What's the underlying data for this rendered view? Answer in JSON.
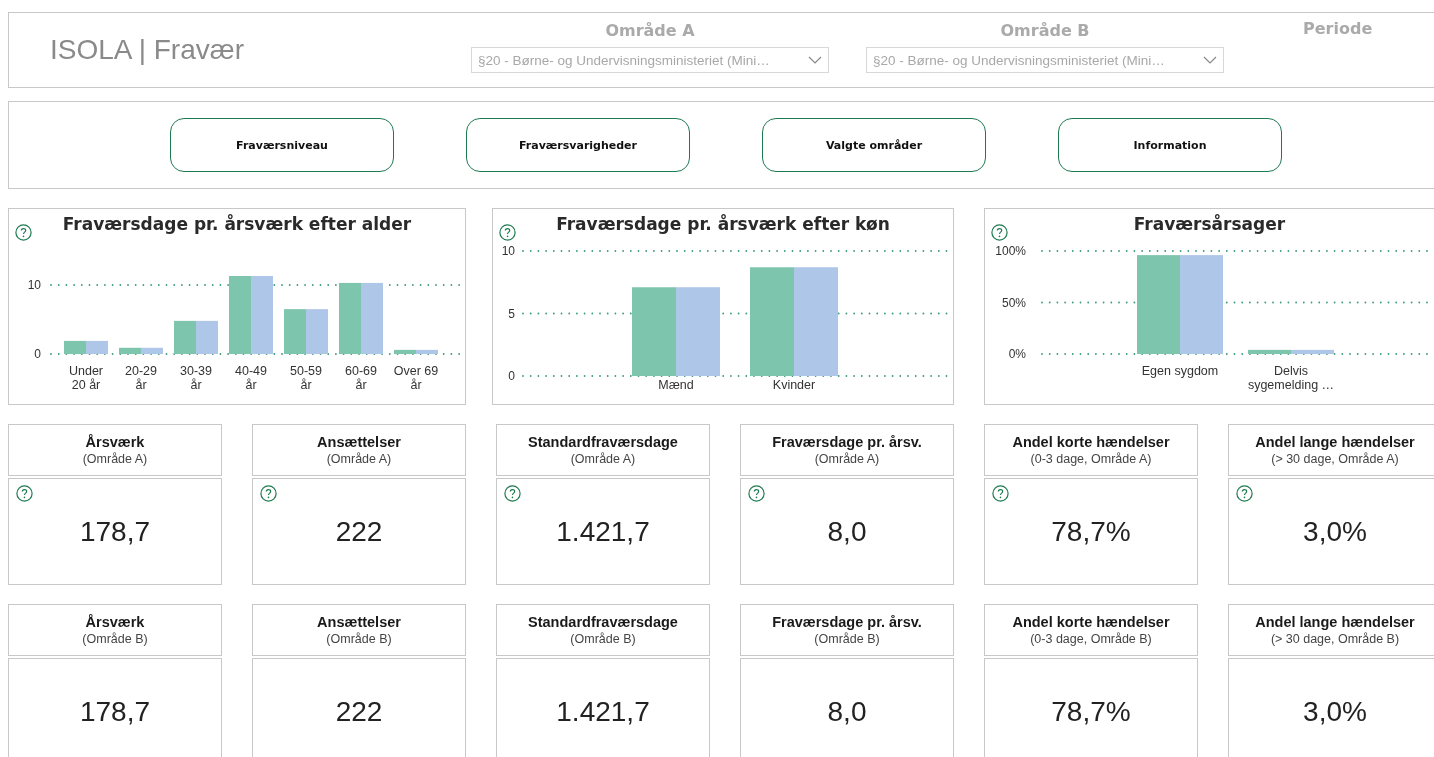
{
  "header": {
    "title": "ISOLA | Fravær",
    "filters": [
      {
        "label": "Område A",
        "value": "§20 - Børne- og Undervisningsministeriet (Mini…"
      },
      {
        "label": "Område B",
        "value": "§20 - Børne- og Undervisningsministeriet (Mini…"
      },
      {
        "label": "Periode"
      }
    ]
  },
  "nav_buttons": [
    "Fraværsniveau",
    "Fraværsvarigheder",
    "Valgte områder",
    "Information"
  ],
  "charts": [
    {
      "help": true,
      "chart_data": {
        "type": "bar",
        "title": "Fraværsdage pr. årsværk efter alder",
        "categories": [
          "Under 20 år",
          "20-29 år",
          "30-39 år",
          "40-49 år",
          "50-59 år",
          "60-69 år",
          "Over 69 år"
        ],
        "ylim": [
          0,
          12
        ],
        "yticks": [
          0,
          10
        ],
        "series": [
          {
            "color": "#7dc5ad",
            "values": [
              1.9,
              0.9,
              4.8,
              11.3,
              6.5,
              10.3,
              0.6
            ]
          },
          {
            "color": "#aec6e8",
            "values": [
              1.9,
              0.9,
              4.8,
              11.3,
              6.5,
              10.3,
              0.6
            ]
          }
        ]
      }
    },
    {
      "help": true,
      "chart_data": {
        "type": "bar",
        "title": "Fraværsdage pr. årsværk efter køn",
        "categories": [
          "Mænd",
          "Kvinder"
        ],
        "ylim": [
          0,
          10
        ],
        "yticks": [
          0,
          5,
          10
        ],
        "series": [
          {
            "color": "#7dc5ad",
            "values": [
              7.1,
              8.7
            ]
          },
          {
            "color": "#aec6e8",
            "values": [
              7.1,
              8.7
            ]
          }
        ]
      }
    },
    {
      "help": true,
      "chart_data": {
        "type": "bar",
        "title": "Fraværsårsager",
        "categories": [
          "Egen sygdom",
          "Delvis sygemelding …"
        ],
        "ylim": [
          0,
          1
        ],
        "yticks": [
          {
            "value": 0,
            "label": "0%"
          },
          {
            "value": 0.5,
            "label": "50%"
          },
          {
            "value": 1,
            "label": "100%"
          }
        ],
        "series": [
          {
            "color": "#7dc5ad",
            "values": [
              0.96,
              0.04
            ]
          },
          {
            "color": "#aec6e8",
            "values": [
              0.96,
              0.04
            ]
          }
        ]
      }
    }
  ],
  "card_rows": [
    {
      "cards": [
        {
          "title": "Årsværk",
          "subtitle": "(Område A)",
          "value": "178,7",
          "help": true
        },
        {
          "title": "Ansættelser",
          "subtitle": "(Område A)",
          "value": "222",
          "help": true
        },
        {
          "title": "Standardfraværsdage",
          "subtitle": "(Område A)",
          "value": "1.421,7",
          "help": true
        },
        {
          "title": "Fraværsdage pr. årsv.",
          "subtitle": "(Område A)",
          "value": "8,0",
          "help": true
        },
        {
          "title": "Andel korte hændelser",
          "subtitle": "(0-3 dage, Område A)",
          "value": "78,7%",
          "help": true
        },
        {
          "title": "Andel lange hændelser",
          "subtitle": "(> 30 dage, Område A)",
          "value": "3,0%",
          "help": true
        }
      ]
    },
    {
      "cards": [
        {
          "title": "Årsværk",
          "subtitle": "(Område B)",
          "value": "178,7",
          "help": false
        },
        {
          "title": "Ansættelser",
          "subtitle": "(Område B)",
          "value": "222",
          "help": false
        },
        {
          "title": "Standardfraværsdage",
          "subtitle": "(Område B)",
          "value": "1.421,7",
          "help": false
        },
        {
          "title": "Fraværsdage pr. årsv.",
          "subtitle": "(Område B)",
          "value": "8,0",
          "help": false
        },
        {
          "title": "Andel korte hændelser",
          "subtitle": "(0-3 dage, Område B)",
          "value": "78,7%",
          "help": false
        },
        {
          "title": "Andel lange hændelser",
          "subtitle": "(> 30 dage, Område B)",
          "value": "3,0%",
          "help": false
        }
      ]
    }
  ]
}
